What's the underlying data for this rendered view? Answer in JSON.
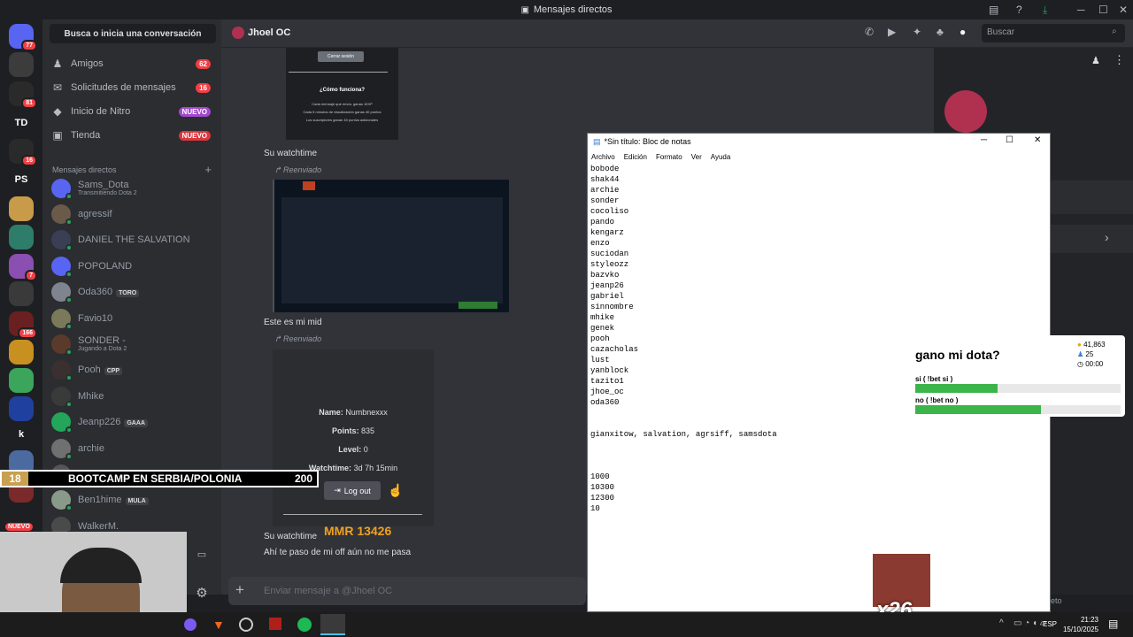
{
  "window_title": "Mensajes directos",
  "guilds": [
    {
      "label": "",
      "badge": "77",
      "color": "#5865f2"
    },
    {
      "label": "",
      "badge": "",
      "color": "#3c3c3c"
    },
    {
      "label": "",
      "badge": "81",
      "color": "#2a2a2a"
    },
    {
      "label": "TD",
      "badge": "",
      "color": "#1e1f22"
    },
    {
      "label": "",
      "badge": "16",
      "color": "#2a2a2a"
    },
    {
      "label": "PS",
      "badge": "",
      "color": "#1e1f22"
    },
    {
      "label": "",
      "badge": "",
      "color": "#c89b4a"
    },
    {
      "label": "",
      "badge": "",
      "color": "#2e7d6a"
    },
    {
      "label": "",
      "badge": "7",
      "color": "#8a4fb0"
    },
    {
      "label": "",
      "badge": "",
      "color": "#3a3a3a"
    },
    {
      "label": "",
      "badge": "166",
      "color": "#6a2020"
    },
    {
      "label": "",
      "badge": "",
      "color": "#c89020"
    },
    {
      "label": "",
      "badge": "",
      "color": "#3ba55c"
    },
    {
      "label": "",
      "badge": "",
      "color": "#2040a0"
    },
    {
      "label": "k",
      "badge": "",
      "color": "#1e1f22"
    },
    {
      "label": "",
      "badge": "",
      "color": "#4a6aa0"
    },
    {
      "label": "",
      "badge": "",
      "color": "#7a2a2a"
    }
  ],
  "guild_new_label": "NUEVO",
  "search_conversation": "Busca o inicia una conversación",
  "nav": [
    {
      "label": "Amigos",
      "badge": "62",
      "icon": "friends-icon"
    },
    {
      "label": "Solicitudes de mensajes",
      "badge": "16",
      "icon": "envelope-icon"
    },
    {
      "label": "Inicio de Nitro",
      "badge": "NUEVO",
      "icon": "nitro-icon"
    },
    {
      "label": "Tienda",
      "badge": "NUEVO",
      "icon": "shop-icon"
    }
  ],
  "dm_header": "Mensajes directos",
  "dms": [
    {
      "name": "Sams_Dota",
      "sub": "Transmitiendo Dota 2",
      "tag": "",
      "color": "#5865f2"
    },
    {
      "name": "agressif",
      "sub": "",
      "tag": "",
      "color": "#6a5a4a"
    },
    {
      "name": "DANIEL THE SALVATION",
      "sub": "",
      "tag": "",
      "color": "#3a3f55"
    },
    {
      "name": "POPOLAND",
      "sub": "",
      "tag": "",
      "color": "#5865f2"
    },
    {
      "name": "Oda360",
      "sub": "",
      "tag": "TORO",
      "color": "#80848e"
    },
    {
      "name": "Favio10",
      "sub": "",
      "tag": "",
      "color": "#7a7a5a"
    },
    {
      "name": "SONDER -",
      "sub": "Jugando a Dota 2",
      "tag": "",
      "color": "#5a3a2a"
    },
    {
      "name": "Pooh",
      "sub": "",
      "tag": "CPP",
      "color": "#3a3030"
    },
    {
      "name": "Mhike",
      "sub": "",
      "tag": "",
      "color": "#3a3a3a"
    },
    {
      "name": "Jeanp226",
      "sub": "",
      "tag": "GAAA",
      "color": "#23a55a"
    },
    {
      "name": "archie",
      "sub": "",
      "tag": "",
      "color": "#707070"
    },
    {
      "name": "",
      "sub": "",
      "tag": "",
      "color": "#555555"
    },
    {
      "name": "Ben1hime",
      "sub": "",
      "tag": "MULA",
      "color": "#8a9a8a"
    },
    {
      "name": "WalkerM.",
      "sub": "",
      "tag": "",
      "color": "#4a4a4a"
    }
  ],
  "chat": {
    "contact": "Jhoel OC",
    "search_placeholder": "Buscar",
    "card_logout": "Cerrar sesión",
    "card_how": "¿Cómo funciona?",
    "card_lines": [
      "Cada mensaje que envía, ganas 10XP",
      "Cada 5 minutos de visualización ganas 40 puntos",
      "Los suscriptores ganan 40 puntos adicionales"
    ],
    "msg1": "Su watchtime",
    "forwarded": "Reenviado",
    "msg2": "Este es mi mid",
    "profile": {
      "name_label": "Name:",
      "name": "Numbnexxx",
      "points_label": "Points:",
      "points": "835",
      "level_label": "Level:",
      "level": "0",
      "watch_label": "Watchtime:",
      "watch": "3d 7h 15min",
      "logout": "Log out"
    },
    "msg3": "Su watchtime",
    "msg4": "Ahí te paso de mi off aún no me pasa",
    "input_placeholder": "Enviar mensaje a @Jhoel OC"
  },
  "notepad": {
    "title": "*Sin título: Bloc de notas",
    "menu": [
      "Archivo",
      "Edición",
      "Formato",
      "Ver",
      "Ayuda"
    ],
    "text": "bobode\nshak44\narchie\nsonder\ncocoliso\npando\nkengarz\nenzo\nsuciodan\nstyleozz\nbazvko\njeanp26\ngabriel\nsinnombre\nmhike\ngenek\npooh\ncazacholas\nlust\nyanblock\ntazito1\njhoe_oc\noda360\n\n\ngianxitow, salvation, agrsiff, samsdota\n\n\n\n1000\n10300\n12300\n10"
  },
  "poll": {
    "question": "gano mi dota?",
    "coins": "41,863",
    "people": "25",
    "time": "00:00",
    "options": [
      {
        "label": "si ( !bet si )",
        "fraction": 0.4
      },
      {
        "label": "no ( !bet no )",
        "fraction": 0.61
      }
    ]
  },
  "overlay": {
    "bootcamp_num": "18",
    "bootcamp_text": "BOOTCAMP EN SERBIA/POLONIA",
    "bootcamp_value": "200",
    "mmr": "MMR 13426",
    "multiplier": "x26"
  },
  "taskbar": {
    "lang": "ESP",
    "time": "21:23",
    "date": "15/10/2025"
  },
  "colors": {
    "accent": "#5865f2",
    "online": "#23a55a",
    "badge": "#f23f43",
    "poll_bar": "#3bb54a"
  }
}
